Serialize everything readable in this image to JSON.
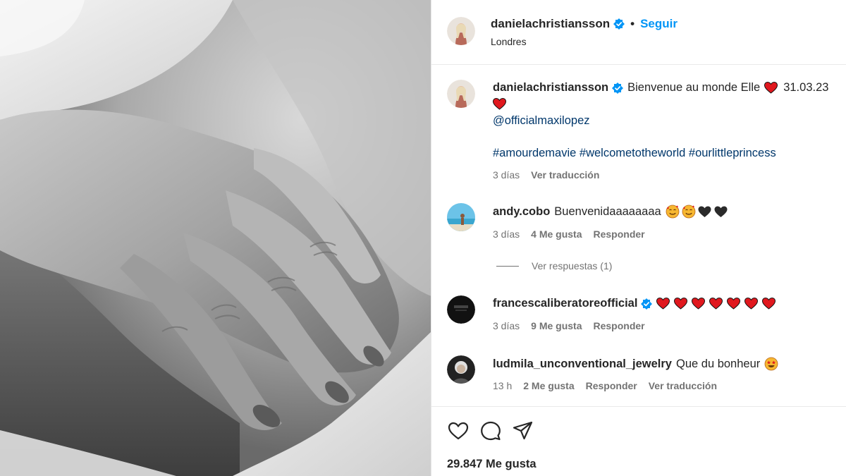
{
  "post": {
    "author": "danielachristiansson",
    "follow_label": "Seguir",
    "separator": "•",
    "location": "Londres"
  },
  "caption": {
    "username": "danielachristiansson",
    "text": "Bienvenue au monde Elle",
    "date": "31.03.23",
    "mention": "@officialmaxilopez",
    "hashtags": "#amourdemavie #welcometotheworld #ourlittleprincess",
    "time": "3 días",
    "translate_label": "Ver traducción"
  },
  "comments": [
    {
      "username": "andy.cobo",
      "text": "Buenvenidaaaaaaaa",
      "time": "3 días",
      "likes": "4 Me gusta",
      "reply_label": "Responder",
      "view_replies": "Ver respuestas (1)"
    },
    {
      "username": "francescaliberatoreofficial",
      "text": "",
      "time": "3 días",
      "likes": "9 Me gusta",
      "reply_label": "Responder"
    },
    {
      "username": "ludmila_unconventional_jewelry",
      "text": "Que du bonheur",
      "time": "13 h",
      "likes": "2 Me gusta",
      "reply_label": "Responder",
      "translate_label": "Ver traducción"
    }
  ],
  "footer": {
    "likes_count": "29.847 Me gusta"
  },
  "icons": {
    "like": "heart-outline-icon",
    "comment": "comment-icon",
    "share": "share-icon",
    "verified": "verified-badge-icon"
  },
  "colors": {
    "accent_blue": "#0095f6",
    "link_blue": "#00376b",
    "verified_blue": "#0095f6",
    "emoji_heart": "#e0181e",
    "muted_text": "#737373"
  }
}
